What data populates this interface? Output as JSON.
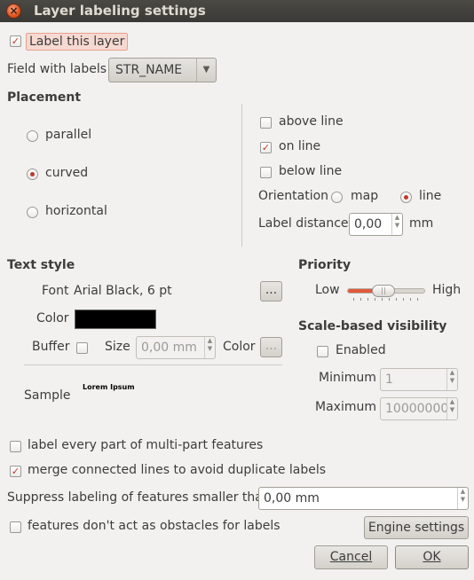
{
  "window": {
    "title": "Layer labeling settings"
  },
  "label_this_layer": {
    "label": "Label this layer",
    "checked": true
  },
  "field_with_labels": {
    "label": "Field with labels",
    "value": "STR_NAME"
  },
  "placement": {
    "title": "Placement",
    "modes": [
      {
        "label": "parallel",
        "selected": false
      },
      {
        "label": "curved",
        "selected": true
      },
      {
        "label": "horizontal",
        "selected": false
      }
    ],
    "above_line": {
      "label": "above line",
      "checked": false
    },
    "on_line": {
      "label": "on line",
      "checked": true
    },
    "below_line": {
      "label": "below line",
      "checked": false
    },
    "orientation": {
      "label": "Orientation",
      "map_label": "map",
      "line_label": "line",
      "selected": "line"
    },
    "label_distance": {
      "label": "Label distance",
      "value": "0,00",
      "unit": "mm"
    }
  },
  "text_style": {
    "title": "Text style",
    "font_label": "Font",
    "font_value": "Arial Black, 6 pt",
    "font_button": "...",
    "color_label": "Color",
    "color_swatch": "#000000",
    "buffer_label": "Buffer",
    "buffer_checked": false,
    "size_label": "Size",
    "size_value": "0,00 mm",
    "buffer_color_label": "Color",
    "buffer_color_button": "...",
    "sample_label": "Sample",
    "sample_text": "Lorem Ipsum"
  },
  "priority": {
    "title": "Priority",
    "low_label": "Low",
    "high_label": "High",
    "level": 0.45
  },
  "scale_visibility": {
    "title": "Scale-based visibility",
    "enabled_label": "Enabled",
    "enabled_checked": false,
    "minimum_label": "Minimum",
    "minimum_value": "1",
    "maximum_label": "Maximum",
    "maximum_value": "10000000"
  },
  "options": {
    "label_every_part": {
      "label": "label every part of multi-part features",
      "checked": false
    },
    "merge_lines": {
      "label": "merge connected lines to avoid duplicate labels",
      "checked": true
    },
    "suppress": {
      "label": "Suppress labeling of features smaller than",
      "value": "0,00 mm"
    },
    "no_obstacles": {
      "label": "features don't act as obstacles for labels",
      "checked": false
    }
  },
  "buttons": {
    "engine_settings": "Engine settings",
    "cancel": "Cancel",
    "ok": "OK"
  },
  "colors": {
    "accent": "#c0392b",
    "titlebar": "#3f3e3a"
  }
}
